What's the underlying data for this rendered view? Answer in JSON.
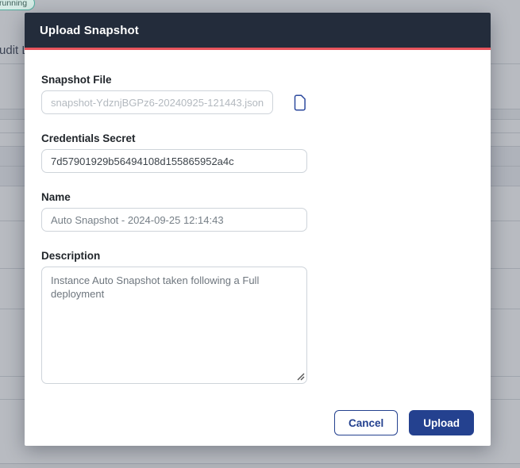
{
  "background": {
    "status_badge_label": "running",
    "tab_label": "Audit Log"
  },
  "modal": {
    "title": "Upload Snapshot",
    "fields": {
      "snapshot_file": {
        "label": "Snapshot File",
        "placeholder": "snapshot-YdznjBGPz6-20240925-121443.json",
        "icon": "file-icon"
      },
      "credentials_secret": {
        "label": "Credentials Secret",
        "value": "7d57901929b56494108d155865952a4c"
      },
      "name": {
        "label": "Name",
        "value": "Auto Snapshot - 2024-09-25 12:14:43"
      },
      "description": {
        "label": "Description",
        "value": "Instance Auto Snapshot taken following a Full deployment"
      }
    },
    "buttons": {
      "cancel_label": "Cancel",
      "upload_label": "Upload"
    }
  },
  "colors": {
    "header_bg": "#232c3b",
    "accent_divider": "#e8545c",
    "primary": "#24418f",
    "badge_border": "#4fae9e",
    "badge_bg": "#d6ece6",
    "file_icon_blue": "#2d4a9e"
  }
}
